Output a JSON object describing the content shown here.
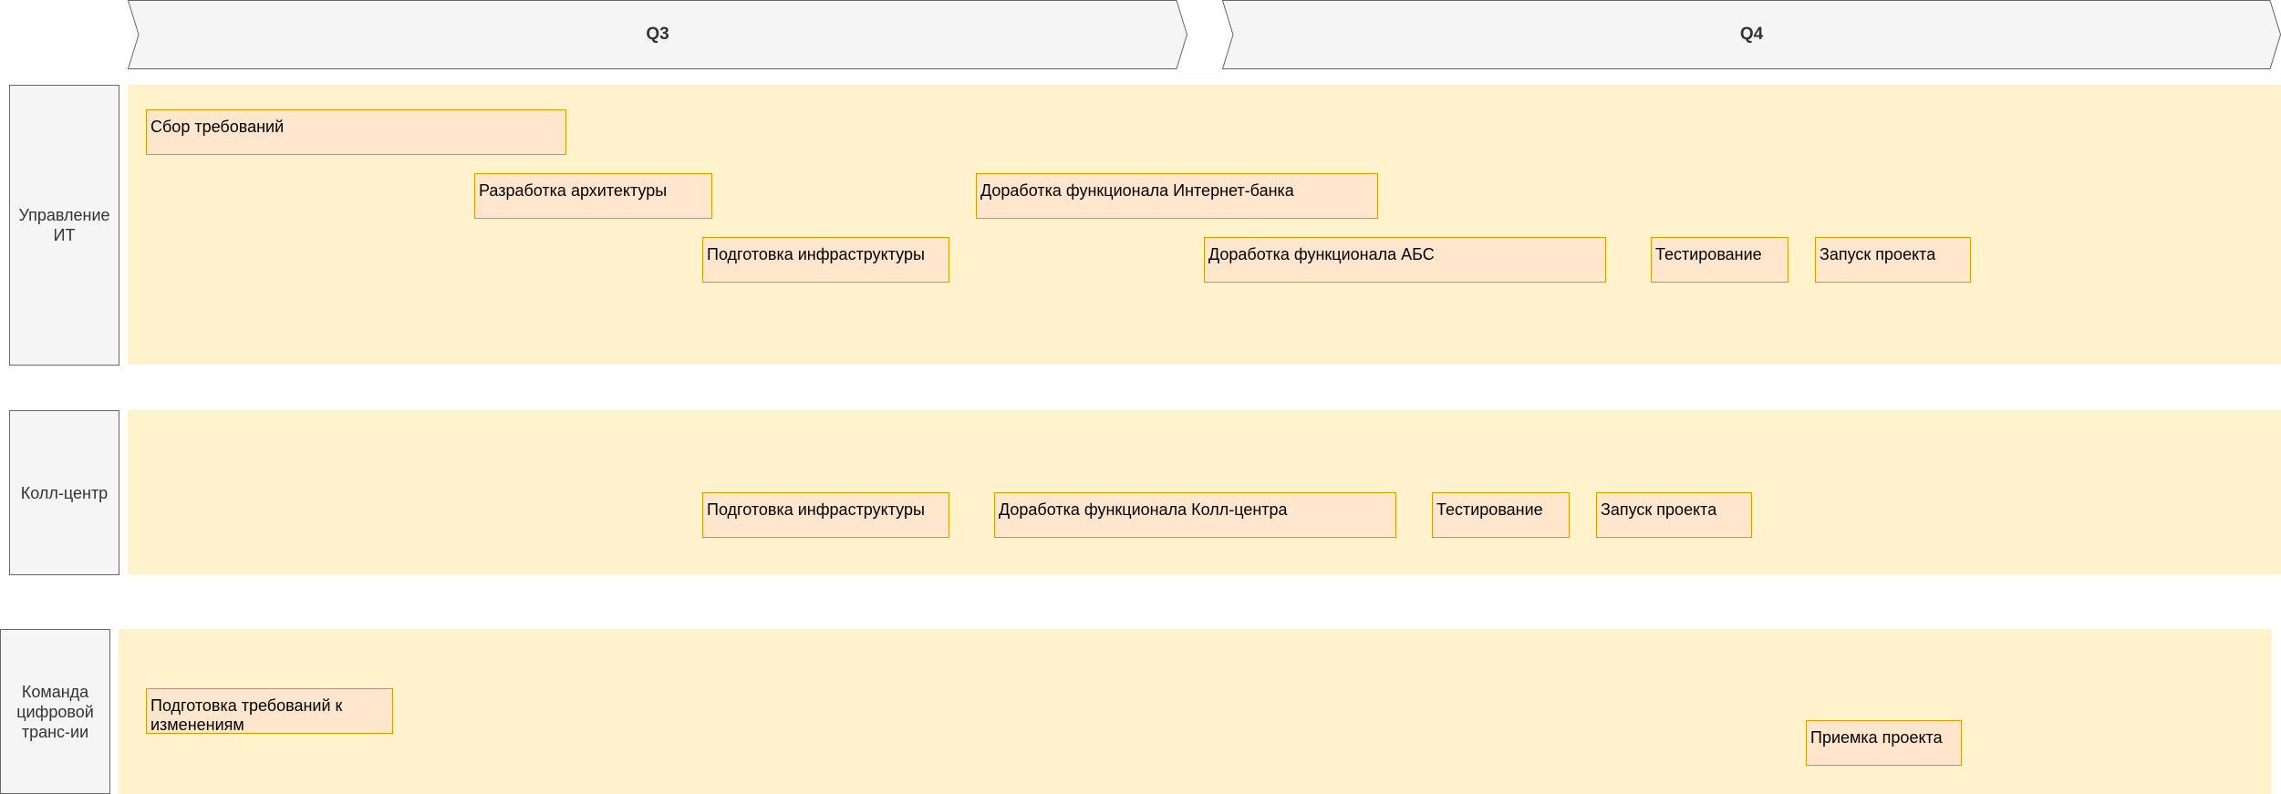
{
  "quarters": [
    {
      "id": "q3",
      "label": "Q3"
    },
    {
      "id": "q4",
      "label": "Q4"
    }
  ],
  "lanes": [
    {
      "id": "it",
      "label": "Управление ИТ"
    },
    {
      "id": "call",
      "label": "Колл-центр"
    },
    {
      "id": "digital",
      "label": "Команда цифровой транс-ии"
    }
  ],
  "tasks": {
    "it": [
      "Сбор требований",
      "Разработка архитектуры",
      "Доработка функционала Интернет-банка",
      "Подготовка инфраструктуры",
      "Доработка функционала АБС",
      "Тестирование",
      "Запуск проекта"
    ],
    "call": [
      "Подготовка инфраструктуры",
      "Доработка функционала Колл-центра",
      "Тестирование",
      "Запуск проекта"
    ],
    "digital": [
      "Подготовка требований к изменениям",
      "Приемка проекта"
    ]
  },
  "colors": {
    "header_fill": "#f5f5f5",
    "header_stroke": "#666666",
    "lane_fill": "#fff2cc",
    "task_fill": "#ffe6cc",
    "task_stroke": "#d79b00"
  }
}
